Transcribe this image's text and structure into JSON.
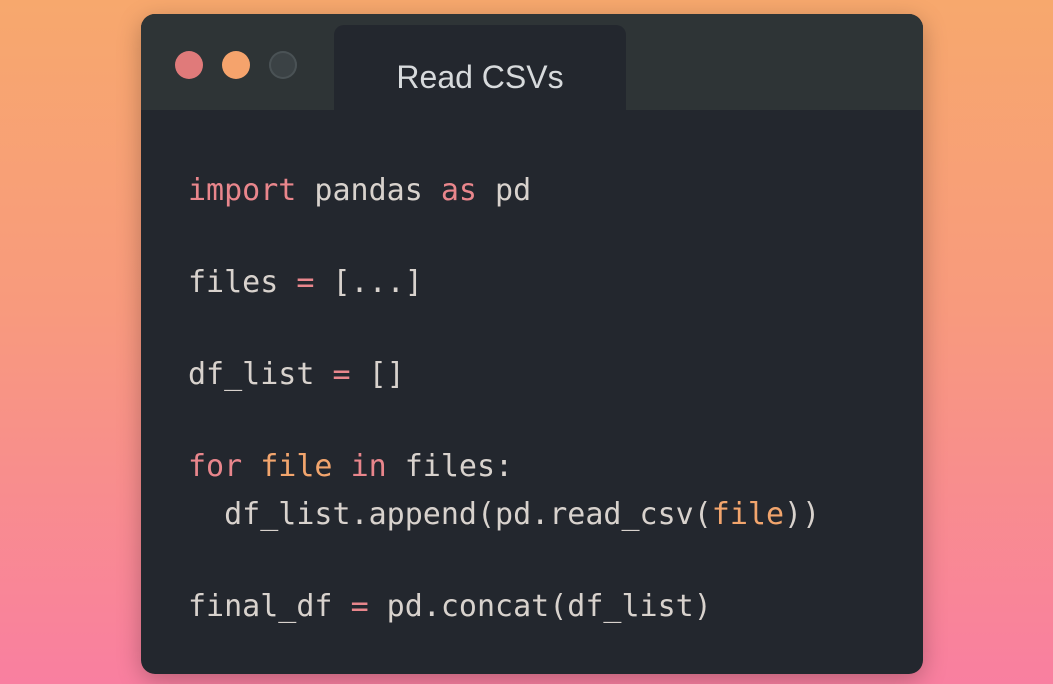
{
  "window": {
    "title": "Read CSVs",
    "traffic_lights": [
      "close",
      "minimize",
      "maximize"
    ]
  },
  "code": {
    "line1": {
      "kw1": "import",
      "t1": " pandas ",
      "kw2": "as",
      "t2": " pd"
    },
    "line2": {
      "t1": "files ",
      "op": "=",
      "t2": " [...]"
    },
    "line3": {
      "t1": "df_list ",
      "op": "=",
      "t2": " []"
    },
    "line4": {
      "kw1": "for",
      "sp1": " ",
      "var": "file",
      "sp2": " ",
      "kw2": "in",
      "t1": " files:"
    },
    "line5": {
      "t1": "  df_list.append(pd.read_csv(",
      "var": "file",
      "t2": "))"
    },
    "line6": {
      "t1": "final_df ",
      "op": "=",
      "t2": " pd.concat(df_list)"
    }
  },
  "colors": {
    "background_top": "#f7a86d",
    "background_bottom": "#f97fa0",
    "window": "#23272e",
    "titlebar": "#2e3436",
    "keyword": "#e9868c",
    "variable": "#f2a56d",
    "text": "#d8d2cd"
  }
}
